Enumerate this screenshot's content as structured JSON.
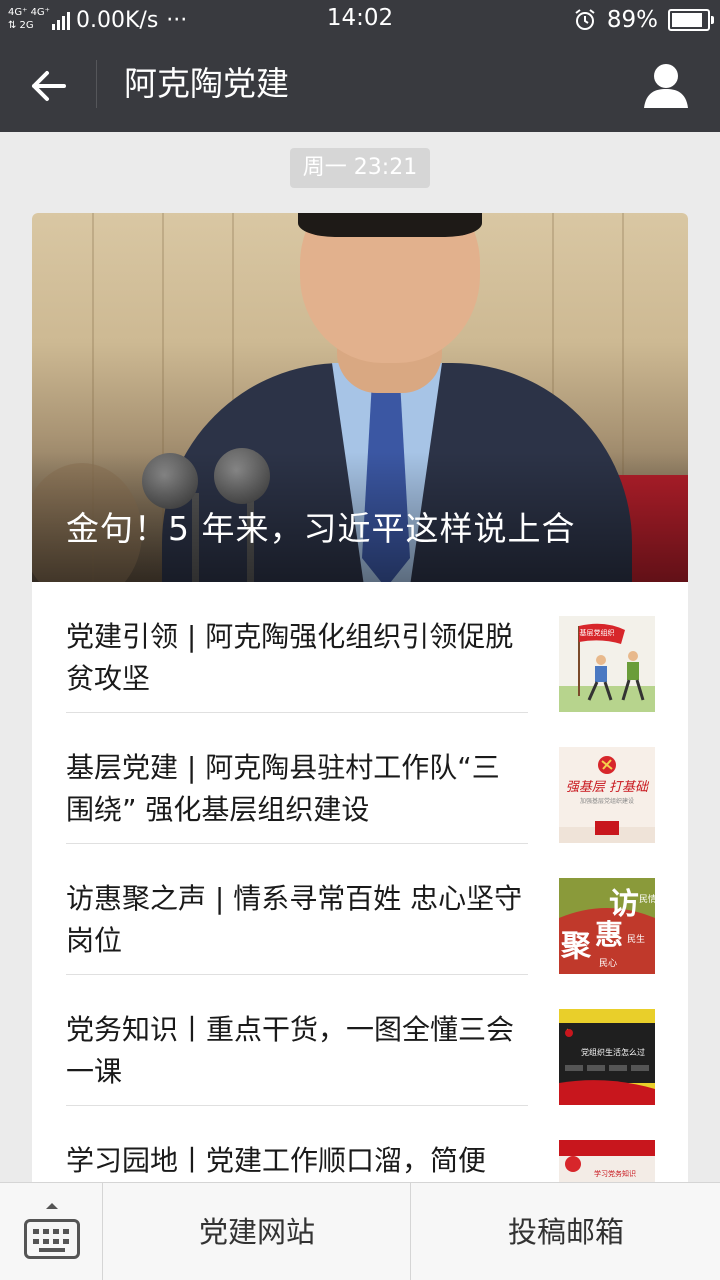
{
  "status_bar": {
    "net_top": "4G⁺ 4G⁺",
    "net_bottom": "⇅   2G",
    "speed": "0.00K/s",
    "more": "···",
    "time": "14:02",
    "battery_percent": "89%",
    "battery_level": 0.89
  },
  "nav": {
    "title": "阿克陶党建",
    "back_icon": "arrow-left-icon",
    "profile_icon": "user-profile-icon"
  },
  "chat": {
    "timestamp": "周一 23:21"
  },
  "article_card": {
    "hero": {
      "title": "金句！5 年来，习近平这样说上合"
    },
    "items": [
      {
        "title": "党建引领 | 阿克陶强化组织引领促脱贫攻坚",
        "thumb_text": "基层党组织"
      },
      {
        "title": "基层党建 | 阿克陶县驻村工作队“三围绕” 强化基层组织建设",
        "thumb_text": "强基层 打基础",
        "thumb_sub": "加强基层党组织建设"
      },
      {
        "title": "访惠聚之声 | 情系寻常百姓 忠心坚守岗位",
        "thumb_text_1": "访",
        "thumb_text_2": "惠",
        "thumb_text_3": "聚",
        "thumb_text_4": "民情",
        "thumb_text_5": "民生",
        "thumb_text_6": "民心"
      },
      {
        "title": "党务知识丨重点干货，一图全懂三会一课",
        "thumb_text": "党组织生活怎么过"
      },
      {
        "title": "学习园地丨党建工作顺口溜，简便",
        "thumb_text": "学习党务知识"
      }
    ]
  },
  "bottom_bar": {
    "keyboard_icon": "keyboard-icon",
    "menu": [
      "党建网站",
      "投稿邮箱"
    ]
  },
  "colors": {
    "header_bg": "#393a3f",
    "page_bg": "#ebebeb",
    "party_red": "#c8161d"
  }
}
